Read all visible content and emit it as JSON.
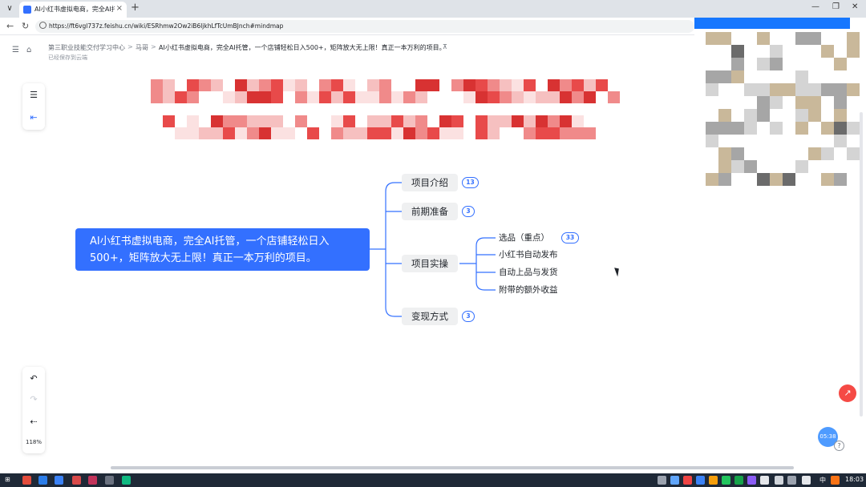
{
  "browser": {
    "tab_title": "AI小红书虚拟电商，完全AI托管，",
    "tab_close": "×",
    "new_tab": "+",
    "tab_menu": "∨",
    "url": "https://ft6vgl737z.feishu.cn/wiki/ESRhmw2Ow2iB6ljkhLfTcUmBJnch#mindmap",
    "win_min": "—",
    "win_max": "❐",
    "win_close": "✕",
    "back": "←",
    "reload": "↻"
  },
  "breadcrumb": {
    "items": [
      "第三职业技能交付学习中心",
      "马哥",
      "AI小红书虚拟电商，完全AI托管，一个店铺轻松日入500+，矩阵放大无上限！真正一本万利的项目。"
    ],
    "separator": ">",
    "pin_icon": "⊼",
    "saved_status": "已经保存到云端"
  },
  "left_toolbar": {
    "outline_icon": "☰",
    "structure_icon": "⇤",
    "undo_icon": "↶",
    "redo_icon": "↷",
    "collapse_icon": "⇠",
    "zoom_label": "118%"
  },
  "mindmap": {
    "root": "AI小红书虚拟电商，完全AI托管，一个店铺轻松日入500+，矩阵放大无上限！真正一本万利的项目。",
    "branches": [
      {
        "label": "项目介绍",
        "badge": "13"
      },
      {
        "label": "前期准备",
        "badge": "3"
      },
      {
        "label": "项目实操",
        "children": [
          {
            "label": "选品（重点）",
            "badge": "33"
          },
          {
            "label": "小红书自动发布"
          },
          {
            "label": "自动上品与发货"
          },
          {
            "label": "附带的额外收益"
          }
        ]
      },
      {
        "label": "变现方式",
        "badge": "3"
      }
    ]
  },
  "colors": {
    "accent": "#3370ff",
    "node_bg": "#eff0f1",
    "connector": "#3370ff",
    "mosaic_red": "#e03a3a"
  },
  "float": {
    "red_button_icon": "↗",
    "timer": "05:38",
    "help": "?"
  },
  "taskbar": {
    "time": "18:03",
    "lang": "中"
  }
}
